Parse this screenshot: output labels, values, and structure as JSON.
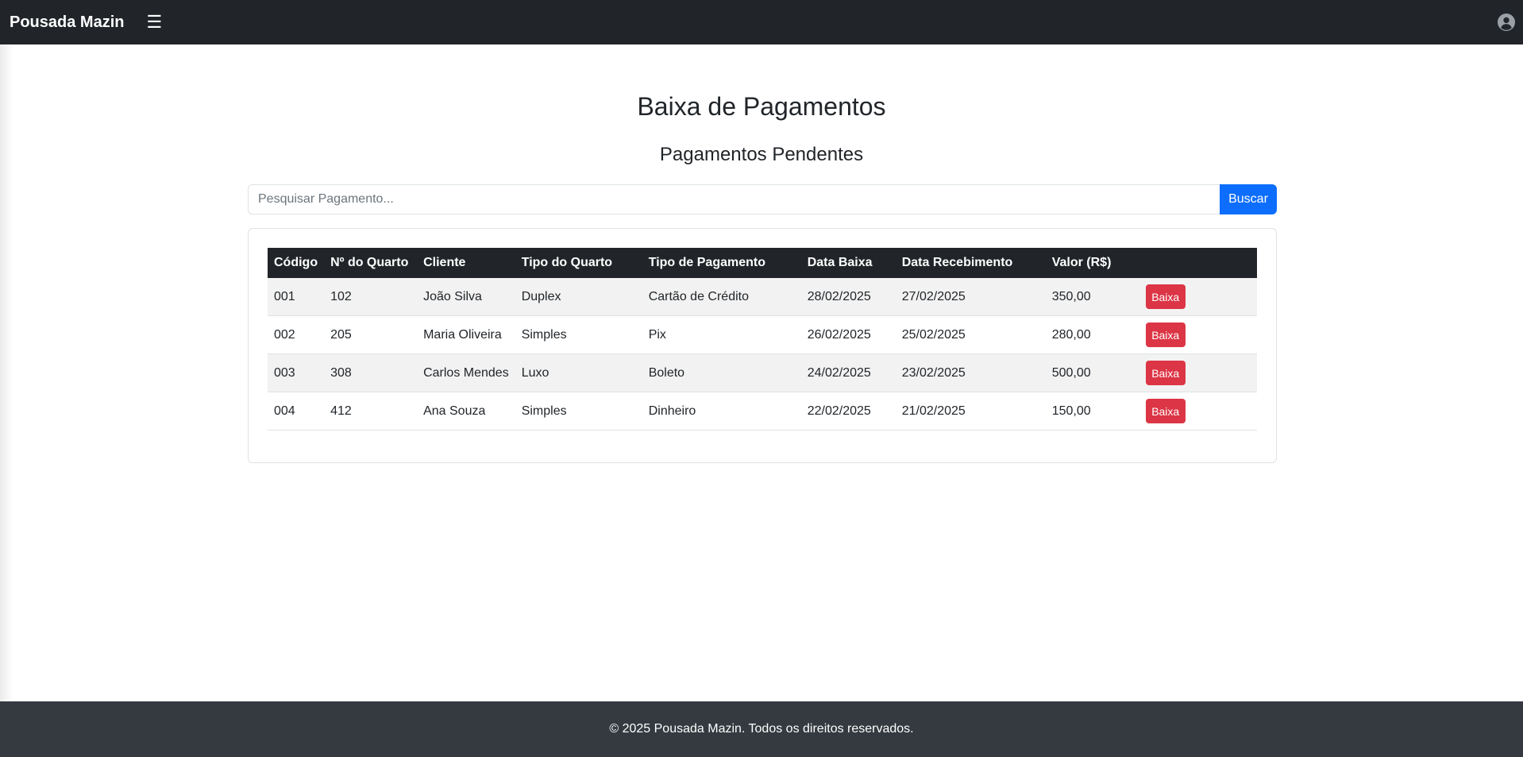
{
  "navbar": {
    "brand": "Pousada Mazin",
    "menu_icon": "hamburger-icon",
    "user_icon": "user-circle-icon"
  },
  "page": {
    "title": "Baixa de Pagamentos",
    "subtitle": "Pagamentos Pendentes"
  },
  "search": {
    "placeholder": "Pesquisar Pagamento...",
    "value": "",
    "button_label": "Buscar"
  },
  "table": {
    "headers": [
      "Código",
      "Nº do Quarto",
      "Cliente",
      "Tipo do Quarto",
      "Tipo de Pagamento",
      "Data Baixa",
      "Data Recebimento",
      "Valor (R$)",
      ""
    ],
    "rows": [
      {
        "codigo": "001",
        "quarto": "102",
        "cliente": "João Silva",
        "tipo_quarto": "Duplex",
        "tipo_pagamento": "Cartão de Crédito",
        "data_baixa": "28/02/2025",
        "data_recebimento": "27/02/2025",
        "valor": "350,00",
        "action": "Baixa"
      },
      {
        "codigo": "002",
        "quarto": "205",
        "cliente": "Maria Oliveira",
        "tipo_quarto": "Simples",
        "tipo_pagamento": "Pix",
        "data_baixa": "26/02/2025",
        "data_recebimento": "25/02/2025",
        "valor": "280,00",
        "action": "Baixa"
      },
      {
        "codigo": "003",
        "quarto": "308",
        "cliente": "Carlos Mendes",
        "tipo_quarto": "Luxo",
        "tipo_pagamento": "Boleto",
        "data_baixa": "24/02/2025",
        "data_recebimento": "23/02/2025",
        "valor": "500,00",
        "action": "Baixa"
      },
      {
        "codigo": "004",
        "quarto": "412",
        "cliente": "Ana Souza",
        "tipo_quarto": "Simples",
        "tipo_pagamento": "Dinheiro",
        "data_baixa": "22/02/2025",
        "data_recebimento": "21/02/2025",
        "valor": "150,00",
        "action": "Baixa"
      }
    ]
  },
  "footer": {
    "text": "© 2025 Pousada Mazin. Todos os direitos reservados."
  },
  "colors": {
    "navbar_bg": "#212529",
    "primary": "#0d6efd",
    "danger": "#dc3545",
    "footer_bg": "#343a40"
  }
}
